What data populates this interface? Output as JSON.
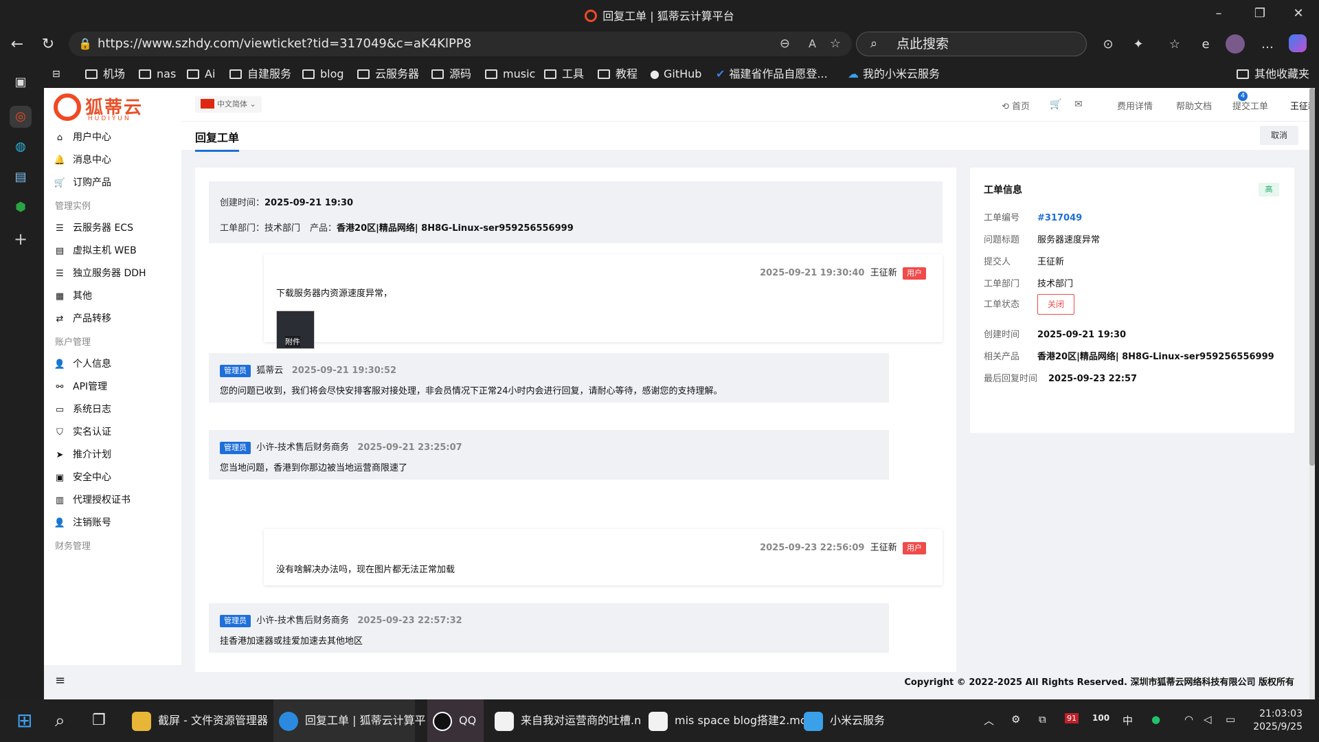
{
  "window": {
    "title": "回复工单 | 狐蒂云计算平台"
  },
  "browser": {
    "url": "https://www.szhdy.com/viewticket?tid=317049&c=aK4KlPP8",
    "search_placeholder": "点此搜索"
  },
  "bookmarks": [
    "机场",
    "nas",
    "Ai",
    "自建服务",
    "blog",
    "云服务器",
    "源码",
    "music",
    "工具",
    "教程",
    "GitHub",
    "福建省作品自愿登...",
    "我的小米云服务",
    "其他收藏夹"
  ],
  "site": {
    "brand": "狐蒂云",
    "brand_en": "HUDIYUN",
    "lang": "中文简体",
    "header_links": {
      "home": "首页",
      "mail_count": "4",
      "fees": "费用详情",
      "docs": "帮助文档",
      "submit": "提交工单",
      "user": "王征新"
    }
  },
  "sidebar": {
    "items": [
      {
        "label": "用户中心",
        "icon": "home-icon"
      },
      {
        "label": "消息中心",
        "icon": "bell-icon"
      },
      {
        "label": "订购产品",
        "icon": "cart-icon"
      },
      {
        "group": "管理实例"
      },
      {
        "label": "云服务器 ECS",
        "icon": "server-icon"
      },
      {
        "label": "虚拟主机 WEB",
        "icon": "host-icon"
      },
      {
        "label": "独立服务器 DDH",
        "icon": "server-icon"
      },
      {
        "label": "其他",
        "icon": "grid-icon"
      },
      {
        "label": "产品转移",
        "icon": "transfer-icon"
      },
      {
        "group": "账户管理"
      },
      {
        "label": "个人信息",
        "icon": "user-icon"
      },
      {
        "label": "API管理",
        "icon": "share-icon"
      },
      {
        "label": "系统日志",
        "icon": "log-icon"
      },
      {
        "label": "实名认证",
        "icon": "shield-icon"
      },
      {
        "label": "推介计划",
        "icon": "send-icon"
      },
      {
        "label": "安全中心",
        "icon": "id-card-icon"
      },
      {
        "label": "代理授权证书",
        "icon": "certificate-icon"
      },
      {
        "label": "注销账号",
        "icon": "user-icon"
      },
      {
        "group": "财务管理"
      }
    ]
  },
  "page": {
    "title": "回复工单",
    "cancel": "取消"
  },
  "ticket": {
    "created_label": "创建时间：",
    "created": "2025-09-21 19:30",
    "dept_label": "工单部门：",
    "dept": "技术部门",
    "product_label": "产品：",
    "product": "香港20区|精品网络| 8H8G-Linux-ser959256556999"
  },
  "messages": [
    {
      "role": "user",
      "time": "2025-09-21 19:30:40",
      "name": "王征新",
      "tag": "用户",
      "text": "下载服务器内资源速度异常，",
      "attachment": "附件"
    },
    {
      "role": "admin",
      "tag": "管理员",
      "name": "狐蒂云",
      "time": "2025-09-21 19:30:52",
      "text": "您的问题已收到，我们将会尽快安排客服对接处理，非会员情况下正常24小时内会进行回复，请耐心等待，感谢您的支持理解。"
    },
    {
      "role": "admin",
      "tag": "管理员",
      "name": "小许-技术售后财务商务",
      "time": "2025-09-21 23:25:07",
      "text": "您当地问题，香港到你那边被当地运营商限速了"
    },
    {
      "role": "user",
      "time": "2025-09-23 22:56:09",
      "name": "王征新",
      "tag": "用户",
      "text": "没有啥解决办法吗，现在图片都无法正常加载"
    },
    {
      "role": "admin",
      "tag": "管理员",
      "name": "小许-技术售后财务商务",
      "time": "2025-09-23 22:57:32",
      "text": "挂香港加速器或挂爱加速去其他地区"
    }
  ],
  "info": {
    "title": "工单信息",
    "priority": "高",
    "rows": [
      {
        "k": "工单编号",
        "v": "#317049"
      },
      {
        "k": "问题标题",
        "v": "服务器速度异常"
      },
      {
        "k": "提交人",
        "v": "王征新"
      },
      {
        "k": "工单部门",
        "v": "技术部门"
      },
      {
        "k": "工单状态",
        "v": "关闭"
      },
      {
        "k": "创建时间",
        "v": "2025-09-21 19:30"
      },
      {
        "k": "相关产品",
        "v": "香港20区|精品网络| 8H8G-Linux-ser959256556999"
      },
      {
        "k": "最后回复时间",
        "v": "2025-09-23 22:57"
      }
    ]
  },
  "footer": {
    "copyright": "Copyright © 2022-2025 All Rights Reserved. 深圳市狐蒂云网络科技有限公司 版权所有"
  },
  "taskbar": {
    "apps": [
      "截屏 - 文件资源管理器",
      "回复工单 | 狐蒂云计算平",
      "QQ",
      "来自我对运营商的吐槽.n",
      "mis space blog搭建2.mc",
      "小米云服务"
    ],
    "tray": {
      "badge": "91",
      "battery": "100",
      "ime": "中"
    },
    "time": "21:03:03",
    "date": "2025/9/25"
  },
  "colors": {
    "accent": "#1e6fd9",
    "brand": "#f04a23",
    "user_tag": "#f04a4a",
    "priority_green": "#23a86a"
  }
}
